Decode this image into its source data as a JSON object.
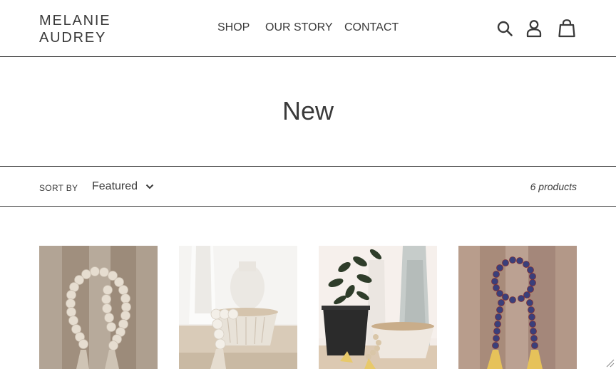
{
  "header": {
    "logo_line1": "MELANIE",
    "logo_line2": "AUDREY",
    "nav": [
      {
        "label": "SHOP"
      },
      {
        "label": "OUR STORY"
      },
      {
        "label": "CONTACT"
      }
    ],
    "icons": [
      "search-icon",
      "account-icon",
      "cart-icon"
    ]
  },
  "collection": {
    "title": "New"
  },
  "filter": {
    "sort_label": "SORT BY",
    "sort_value": "Featured",
    "product_count": "6 products"
  },
  "products": [
    {
      "image": "wood-bead-garland-photo"
    },
    {
      "image": "white-bead-garland-vase-photo"
    },
    {
      "image": "plant-bowl-bead-garland-photo"
    },
    {
      "image": "blue-bead-tassel-garland-photo"
    }
  ],
  "colors": {
    "text": "#3a3a3a",
    "background": "#ffffff",
    "divider": "#3a3a3a"
  }
}
